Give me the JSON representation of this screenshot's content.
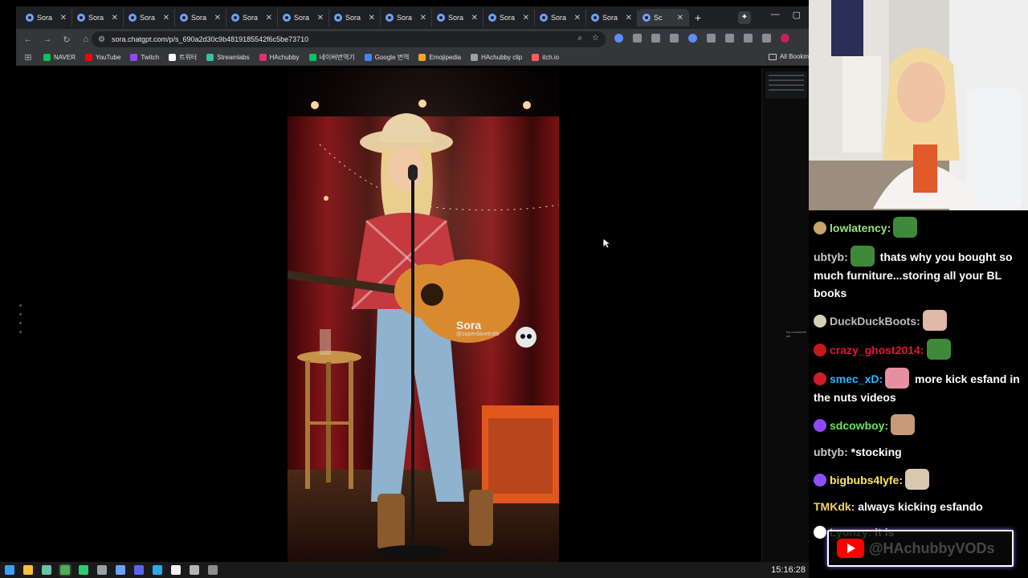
{
  "browser": {
    "tabs": [
      {
        "label": "Sora",
        "active": false
      },
      {
        "label": "Sora",
        "active": false
      },
      {
        "label": "Sora",
        "active": false
      },
      {
        "label": "Sora",
        "active": false
      },
      {
        "label": "Sora",
        "active": false
      },
      {
        "label": "Sora",
        "active": false
      },
      {
        "label": "Sora",
        "active": false
      },
      {
        "label": "Sora",
        "active": false
      },
      {
        "label": "Sora",
        "active": false
      },
      {
        "label": "Sora",
        "active": false
      },
      {
        "label": "Sora",
        "active": false
      },
      {
        "label": "Sora",
        "active": false
      },
      {
        "label": "Sc",
        "active": true
      }
    ],
    "new_tab": "+",
    "url": "sora.chatgpt.com/p/s_690a2d30c9b4819185542f6c5be73710",
    "bookmarks": [
      {
        "label": "NAVER",
        "color": "#03c75a"
      },
      {
        "label": "YouTube",
        "color": "#ff0000"
      },
      {
        "label": "Twitch",
        "color": "#9146ff"
      },
      {
        "label": "트위터",
        "color": "#ffffff"
      },
      {
        "label": "Streamlabs",
        "color": "#31c3a2"
      },
      {
        "label": "HAchubby",
        "color": "#e1306c"
      },
      {
        "label": "네이버번역기",
        "color": "#03c75a"
      },
      {
        "label": "Google 번역",
        "color": "#4285f4"
      },
      {
        "label": "Emojipedia",
        "color": "#f5a623"
      },
      {
        "label": "HAchubby clip",
        "color": "#9aa0a6"
      },
      {
        "label": "itch.io",
        "color": "#fa5c5c"
      }
    ],
    "all_bookmarks": "All Bookm",
    "video": {
      "watermark_title": "Sora",
      "watermark_handle": "@superdavetn86"
    },
    "no_comments": "No comments yet"
  },
  "chat": {
    "messages": [
      {
        "user": "lowlatency:",
        "user_color": "#9be27a",
        "text": "",
        "badge": "#c8a46a",
        "emote": "#3f8a3a"
      },
      {
        "user": "ubtyb:",
        "user_color": "#c9c9c9",
        "text": "thats why you bought so much furniture...storing all your BL books",
        "badge": "",
        "emote": "#3f8a3a"
      },
      {
        "user": "DuckDuckBoots:",
        "user_color": "#bcbcbc",
        "text": "",
        "badge": "#d6cfb4",
        "emote": "#e0b8a8"
      },
      {
        "user": "crazy_ghost2014:",
        "user_color": "#e0182d",
        "text": "",
        "badge": "#c41a1a",
        "emote": "#3f8a3a"
      },
      {
        "user": "smec_xD:",
        "user_color": "#2ab7ff",
        "text": "more kick esfand in the nuts videos",
        "badge": "#d01c2a",
        "emote": "#e68fa0"
      },
      {
        "user": "sdcowboy:",
        "user_color": "#6be35f",
        "text": "",
        "badge": "#9146ff",
        "emote": "#c89a7a"
      },
      {
        "user": "ubtyb:",
        "user_color": "#c9c9c9",
        "text": "*stocking",
        "badge": "",
        "emote": ""
      },
      {
        "user": "bigbubs4lyfe:",
        "user_color": "#ffe55a",
        "text": "",
        "badge": "#8f4fff",
        "emote": "#d8c8b0"
      },
      {
        "user": "TMKdk:",
        "user_color": "#f0d264",
        "text": "always kicking esfando",
        "badge": "",
        "emote": ""
      },
      {
        "user": "Lyonzy:",
        "user_color": "#7de37d",
        "text": "it is",
        "badge": "#ffffff",
        "emote": ""
      }
    ]
  },
  "youtube_handle": "@HAchubbyVODs",
  "taskbar": {
    "clock": "15:16:28",
    "icons": [
      "windows-start-icon",
      "file-explorer-icon",
      "app-icon",
      "chrome-icon",
      "app-icon",
      "app-icon",
      "app-icon",
      "app-icon",
      "discord-icon",
      "telegram-icon",
      "app-icon",
      "app-icon"
    ]
  }
}
